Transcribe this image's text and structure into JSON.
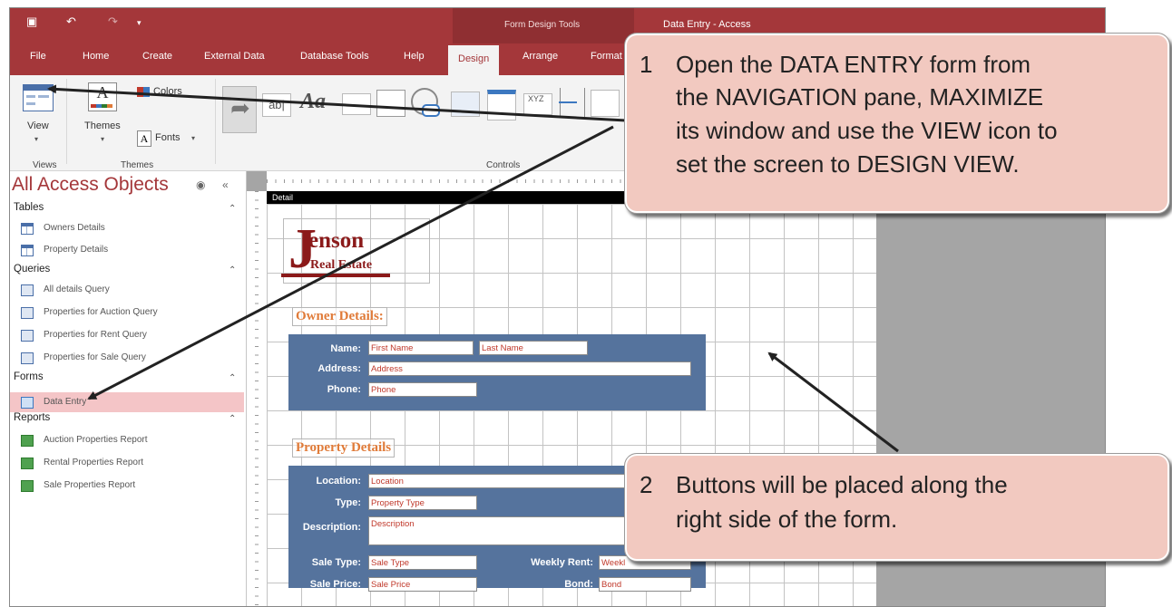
{
  "window": {
    "context_tab_group": "Form Design Tools",
    "app_title": "Data Entry  -  Access"
  },
  "tabs": [
    "File",
    "Home",
    "Create",
    "External Data",
    "Database Tools",
    "Help",
    "Design",
    "Arrange",
    "Format"
  ],
  "active_tab": "Design",
  "ribbon": {
    "view_label": "View",
    "themes_label": "Themes",
    "colors_label": "Colors",
    "fonts_label": "Fonts",
    "fonts_icon_glyph": "A",
    "group_views": "Views",
    "group_themes": "Themes",
    "group_controls": "Controls",
    "textbox_glyph": "ab|",
    "label_glyph": "Aa",
    "xyz_glyph": "XYZ"
  },
  "nav": {
    "title": "All Access Objects",
    "groups": [
      {
        "label": "Tables",
        "items": [
          {
            "label": "Owners Details",
            "icon": "table-icon"
          },
          {
            "label": "Property Details",
            "icon": "table-icon"
          }
        ]
      },
      {
        "label": "Queries",
        "items": [
          {
            "label": "All details Query",
            "icon": "query-icon"
          },
          {
            "label": "Properties for Auction Query",
            "icon": "query-icon"
          },
          {
            "label": "Properties for Rent Query",
            "icon": "query-icon"
          },
          {
            "label": "Properties for Sale Query",
            "icon": "query-icon"
          }
        ]
      },
      {
        "label": "Forms",
        "items": [
          {
            "label": "Data Entry",
            "icon": "form-icon",
            "selected": true
          }
        ]
      },
      {
        "label": "Reports",
        "items": [
          {
            "label": "Auction Properties Report",
            "icon": "report-icon"
          },
          {
            "label": "Rental Properties Report",
            "icon": "report-icon"
          },
          {
            "label": "Sale Properties Report",
            "icon": "report-icon"
          }
        ]
      }
    ]
  },
  "form": {
    "section": "Detail",
    "logo": {
      "initial": "J",
      "name": "enson",
      "sub": "Real Estate"
    },
    "owner_title": "Owner Details:",
    "owner_fields": {
      "name_label": "Name:",
      "first_name": "First Name",
      "last_name": "Last Name",
      "address_label": "Address:",
      "address": "Address",
      "phone_label": "Phone:",
      "phone": "Phone"
    },
    "property_title": "Property Details",
    "property_fields": {
      "location_label": "Location:",
      "location": "Location",
      "type_label": "Type:",
      "type": "Property Type",
      "description_label": "Description:",
      "description": "Description",
      "sale_type_label": "Sale Type:",
      "sale_type": "Sale Type",
      "weekly_rent_label": "Weekly Rent:",
      "weekly_rent": "Weekl",
      "sale_price_label": "Sale Price:",
      "sale_price": "Sale Price",
      "bond_label": "Bond:",
      "bond": "Bond"
    }
  },
  "callouts": [
    {
      "number": "1",
      "lines": [
        "Open the DATA ENTRY form from",
        "the NAVIGATION pane, MAXIMIZE",
        "its window and use the VIEW icon to",
        "set the screen to DESIGN VIEW."
      ]
    },
    {
      "number": "2",
      "lines": [
        "Buttons will be placed along the",
        "right side of the form."
      ]
    }
  ],
  "colors": {
    "access_red": "#a4373a",
    "panel_blue": "#55739d",
    "callout_fill": "#f2c9c0",
    "selected_item": "#f4c5c7"
  }
}
